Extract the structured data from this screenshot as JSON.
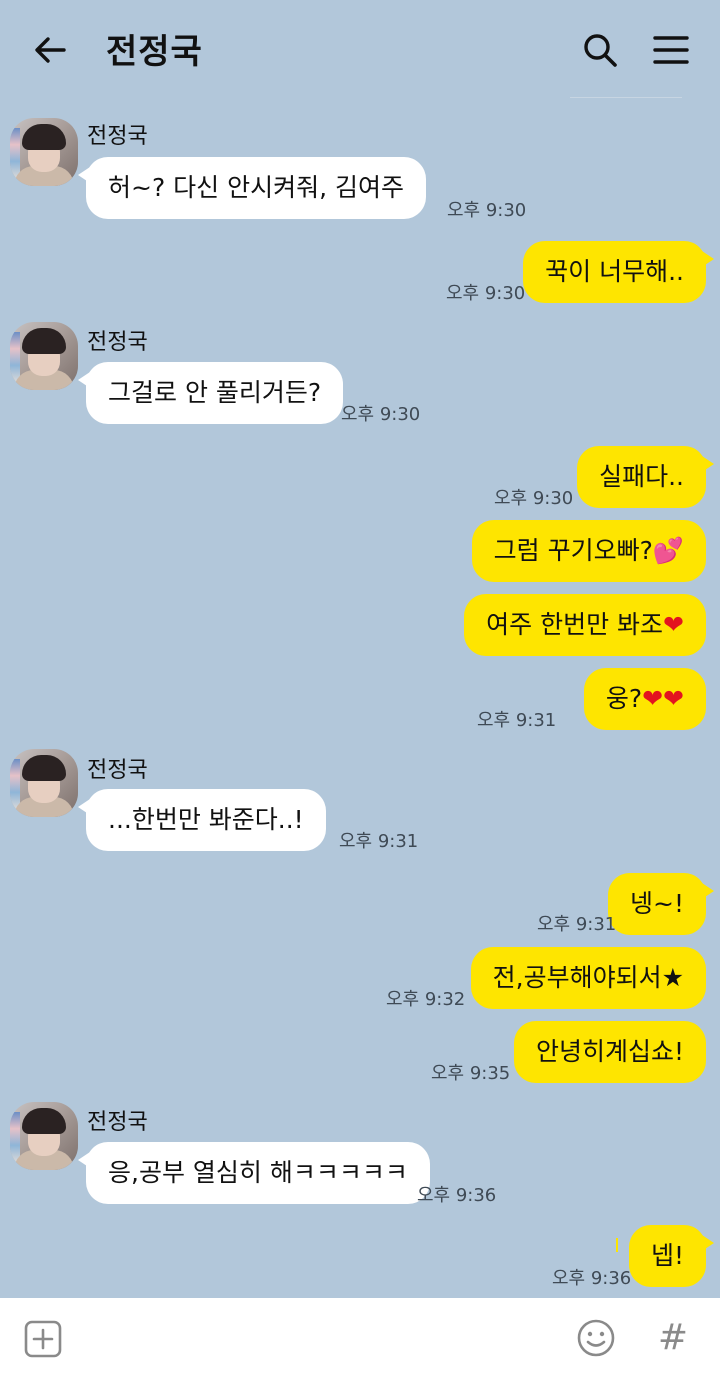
{
  "header": {
    "title": "전정국",
    "back_icon": "back-arrow-icon",
    "search_icon": "search-icon",
    "menu_icon": "hamburger-menu-icon"
  },
  "colors": {
    "background": "#b2c7da",
    "incoming_bubble": "#ffffff",
    "outgoing_bubble": "#fee500",
    "heart": "#e3141f"
  },
  "contact": {
    "name": "전정국"
  },
  "messages": [
    {
      "from": "contact",
      "text": "허~? 다신 안시켜줘, 김여주",
      "time": "오후 9:30"
    },
    {
      "from": "me",
      "text": "꾹이 너무해..",
      "time": "오후 9:30"
    },
    {
      "from": "contact",
      "text": "그걸로 안 풀리거든?",
      "time": "오후 9:30"
    },
    {
      "from": "me",
      "text": "실패다..",
      "time": "오후 9:30"
    },
    {
      "from": "me",
      "text": "그럼 꾸기오빠?💕",
      "time": ""
    },
    {
      "from": "me",
      "text": "여주 한번만 봐조",
      "time": ""
    },
    {
      "from": "me",
      "text": "웅?",
      "time": "오후 9:31"
    },
    {
      "from": "contact",
      "text": "...한번만 봐준다..!",
      "time": "오후 9:31"
    },
    {
      "from": "me",
      "text": "넹~!",
      "time": "오후 9:31"
    },
    {
      "from": "me",
      "text": "전,공부해야되서★",
      "time": "오후 9:32"
    },
    {
      "from": "me",
      "text": "안녕히계십쇼!",
      "time": "오후 9:35"
    },
    {
      "from": "contact",
      "text": "응,공부 열심히 해ㅋㅋㅋㅋㅋ",
      "time": "오후 9:36"
    },
    {
      "from": "me",
      "text": "넵!",
      "time": "오후 9:36"
    }
  ],
  "hearts": "❤",
  "input_bar": {
    "plus_icon": "plus-square-icon",
    "emoji_icon": "smiley-icon",
    "hash_label": "#"
  }
}
